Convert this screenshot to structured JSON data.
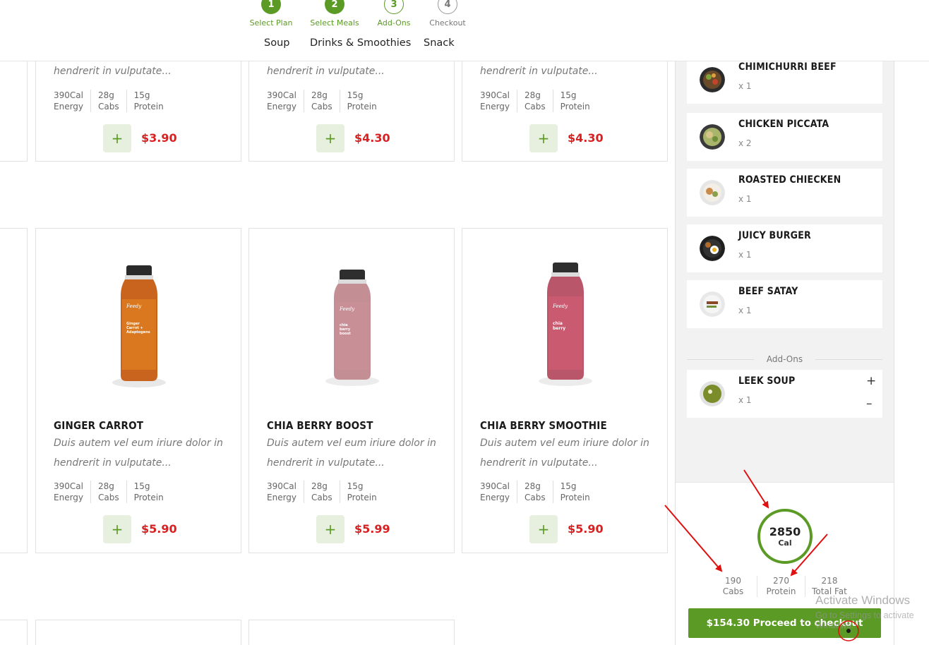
{
  "steps": [
    {
      "num": "1",
      "label": "Select Plan"
    },
    {
      "num": "2",
      "label": "Select Meals"
    },
    {
      "num": "3",
      "label": "Add-Ons"
    },
    {
      "num": "4",
      "label": "Checkout"
    }
  ],
  "categories": [
    "Soup",
    "Drinks & Smoothies",
    "Snack"
  ],
  "top_cards": [
    {
      "desc": "hendrerit in vulputate...",
      "cal": "390Cal",
      "cal_l": "Energy",
      "carb": "28g",
      "carb_l": "Cabs",
      "prot": "15g",
      "prot_l": "Protein",
      "price": "$3.90"
    },
    {
      "desc": "hendrerit in vulputate...",
      "cal": "390Cal",
      "cal_l": "Energy",
      "carb": "28g",
      "carb_l": "Cabs",
      "prot": "15g",
      "prot_l": "Protein",
      "price": "$4.30"
    },
    {
      "desc": "hendrerit in vulputate...",
      "cal": "390Cal",
      "cal_l": "Energy",
      "carb": "28g",
      "carb_l": "Cabs",
      "prot": "15g",
      "prot_l": "Protein",
      "price": "$4.30"
    }
  ],
  "drink_cards": [
    {
      "name": "GINGER CARROT",
      "desc1": "Duis autem vel eum iriure dolor in",
      "desc2": "hendrerit in vulputate...",
      "cal": "390Cal",
      "cal_l": "Energy",
      "carb": "28g",
      "carb_l": "Cabs",
      "prot": "15g",
      "prot_l": "Protein",
      "price": "$5.90"
    },
    {
      "name": "CHIA BERRY BOOST",
      "desc1": "Duis autem vel eum iriure dolor in",
      "desc2": "hendrerit in vulputate...",
      "cal": "390Cal",
      "cal_l": "Energy",
      "carb": "28g",
      "carb_l": "Cabs",
      "prot": "15g",
      "prot_l": "Protein",
      "price": "$5.99"
    },
    {
      "name": "CHIA BERRY SMOOTHIE",
      "desc1": "Duis autem vel eum iriure dolor in",
      "desc2": "hendrerit in vulputate...",
      "cal": "390Cal",
      "cal_l": "Energy",
      "carb": "28g",
      "carb_l": "Cabs",
      "prot": "15g",
      "prot_l": "Protein",
      "price": "$5.90"
    }
  ],
  "add_symbol": "+",
  "cart": {
    "items": [
      {
        "name": "CHIMICHURRI BEEF",
        "qty": "x 1"
      },
      {
        "name": "CHICKEN PICCATA",
        "qty": "x 2"
      },
      {
        "name": "ROASTED CHIECKEN",
        "qty": "x 1"
      },
      {
        "name": "JUICY BURGER",
        "qty": "x 1"
      },
      {
        "name": "BEEF SATAY",
        "qty": "x 1"
      }
    ],
    "addons_label": "Add-Ons",
    "addons": [
      {
        "name": "LEEK SOUP",
        "qty": "x 1",
        "plus": "+",
        "minus": "–"
      }
    ]
  },
  "summary": {
    "calories": "2850",
    "cal_unit": "Cal",
    "macros": [
      {
        "value": "190",
        "label": "Cabs"
      },
      {
        "value": "270",
        "label": "Protein"
      },
      {
        "value": "218",
        "label": "Total Fat"
      }
    ],
    "checkout_label": "$154.30 Proceed to checkout"
  },
  "watermark": {
    "line1": "Activate Windows",
    "line2": "Go to Settings to activate Windows."
  },
  "colors": {
    "accent": "#5b9a24",
    "price": "#d92020",
    "annotation": "#e01010"
  }
}
